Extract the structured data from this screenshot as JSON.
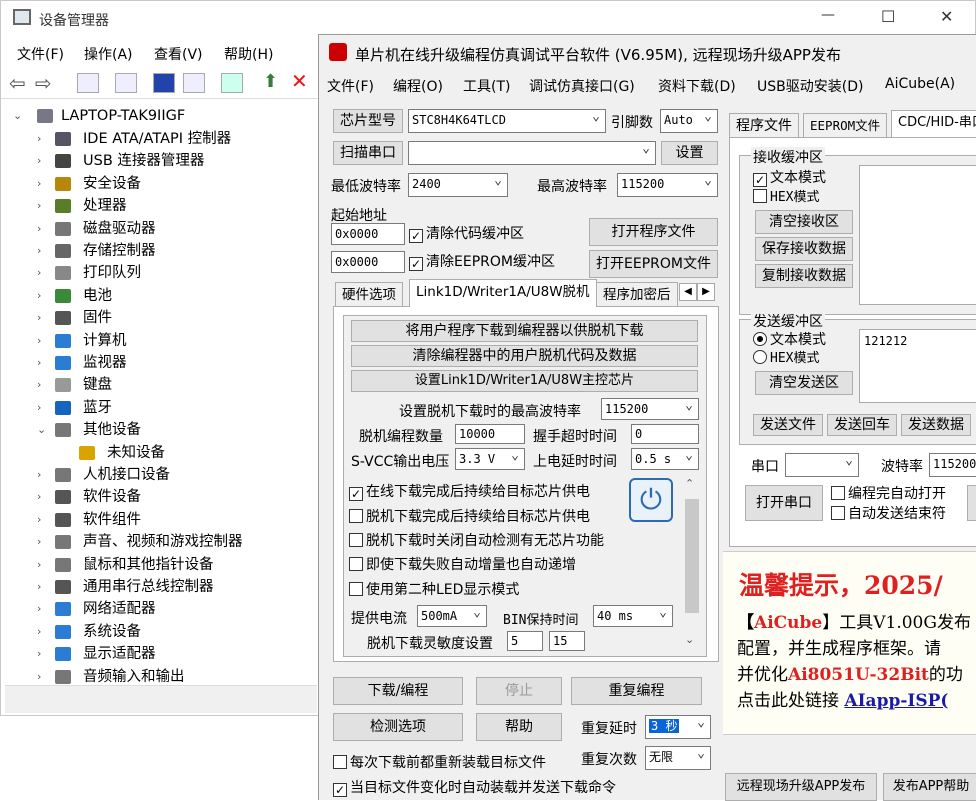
{
  "device_manager": {
    "title": "设备管理器",
    "window_controls": {
      "minimize": "—",
      "maximize": "☐",
      "close": "✕"
    },
    "menu": [
      "文件(F)",
      "操作(A)",
      "查看(V)",
      "帮助(H)"
    ],
    "root": "LAPTOP-TAK9IIGF",
    "tree": [
      {
        "label": "IDE ATA/ATAPI 控制器",
        "icon": "ide-controller-icon",
        "color": "#556"
      },
      {
        "label": "USB 连接器管理器",
        "icon": "usb-connector-icon",
        "color": "#444"
      },
      {
        "label": "安全设备",
        "icon": "security-device-icon",
        "color": "#b8860b"
      },
      {
        "label": "处理器",
        "icon": "processor-icon",
        "color": "#5a7d2a"
      },
      {
        "label": "磁盘驱动器",
        "icon": "disk-drive-icon",
        "color": "#777"
      },
      {
        "label": "存储控制器",
        "icon": "storage-controller-icon",
        "color": "#666"
      },
      {
        "label": "打印队列",
        "icon": "printer-icon",
        "color": "#888"
      },
      {
        "label": "电池",
        "icon": "battery-icon",
        "color": "#3a8a3a"
      },
      {
        "label": "固件",
        "icon": "firmware-icon",
        "color": "#555"
      },
      {
        "label": "计算机",
        "icon": "computer-icon",
        "color": "#2b7cd3"
      },
      {
        "label": "监视器",
        "icon": "monitor-icon",
        "color": "#2b7cd3"
      },
      {
        "label": "键盘",
        "icon": "keyboard-icon",
        "color": "#999"
      },
      {
        "label": "蓝牙",
        "icon": "bluetooth-icon",
        "color": "#1565c0"
      },
      {
        "label": "其他设备",
        "icon": "other-devices-icon",
        "color": "#777",
        "expanded": true
      },
      {
        "label": "未知设备",
        "icon": "unknown-device-warning-icon",
        "color": "#d9a400",
        "child": true
      },
      {
        "label": "人机接口设备",
        "icon": "hid-icon",
        "color": "#777"
      },
      {
        "label": "软件设备",
        "icon": "software-device-icon",
        "color": "#555"
      },
      {
        "label": "软件组件",
        "icon": "software-component-icon",
        "color": "#555"
      },
      {
        "label": "声音、视频和游戏控制器",
        "icon": "sound-icon",
        "color": "#777"
      },
      {
        "label": "鼠标和其他指针设备",
        "icon": "mouse-icon",
        "color": "#777"
      },
      {
        "label": "通用串行总线控制器",
        "icon": "usb-controller-icon",
        "color": "#555"
      },
      {
        "label": "网络适配器",
        "icon": "network-adapter-icon",
        "color": "#2b7cd3"
      },
      {
        "label": "系统设备",
        "icon": "system-device-icon",
        "color": "#2b7cd3"
      },
      {
        "label": "显示适配器",
        "icon": "display-adapter-icon",
        "color": "#2b7cd3"
      },
      {
        "label": "音频输入和输出",
        "icon": "audio-io-icon",
        "color": "#777"
      }
    ]
  },
  "isp": {
    "title": "单片机在线升级编程仿真调试平台软件 (V6.95M), 远程现场升级APP发布",
    "menu": [
      "文件(F)",
      "编程(O)",
      "工具(T)",
      "调试仿真接口(G)",
      "资料下载(D)",
      "USB驱动安装(D)",
      "AiCube(A)"
    ],
    "chip_type_btn": "芯片型号",
    "chip_value": "STC8H4K64TLCD",
    "pin_count_label": "引脚数",
    "pin_count_value": "Auto",
    "scan_port_btn": "扫描串口",
    "port_value": "",
    "settings_btn": "设置",
    "min_baud_label": "最低波特率",
    "min_baud_value": "2400",
    "max_baud_label": "最高波特率",
    "max_baud_value": "115200",
    "start_addr_label": "起始地址",
    "addr1": "0x0000",
    "addr2": "0x0000",
    "clear_code_buf": "清除代码缓冲区",
    "clear_eeprom_buf": "清除EEPROM缓冲区",
    "open_program_btn": "打开程序文件",
    "open_eeprom_btn": "打开EEPROM文件",
    "tabs": [
      "硬件选项",
      "Link1D/Writer1A/U8W脱机",
      "程序加密后"
    ],
    "offline_btn1": "将用户程序下载到编程器以供脱机下载",
    "offline_btn2": "清除编程器中的用户脱机代码及数据",
    "offline_btn3": "设置Link1D/Writer1A/U8W主控芯片",
    "max_offline_baud_label": "设置脱机下载时的最高波特率",
    "max_offline_baud_value": "115200",
    "offline_count_label": "脱机编程数量",
    "offline_count_value": "10000",
    "handshake_label": "握手超时时间",
    "handshake_value": "0",
    "svcc_label": "S-VCC输出电压",
    "svcc_value": "3.3 V",
    "power_delay_label": "上电延时时间",
    "power_delay_value": "0.5 s",
    "opt1": "在线下载完成后持续给目标芯片供电",
    "opt2": "脱机下载完成后持续给目标芯片供电",
    "opt3": "脱机下载时关闭自动检测有无芯片功能",
    "opt4": "即使下载失败自动增量也自动递增",
    "opt5": "使用第二种LED显示模式",
    "current_label": "提供电流",
    "current_value": "500mA",
    "bin_hold_label": "BIN保持时间",
    "bin_hold_value": "40 ms",
    "sensitivity_label": "脱机下载灵敏度设置",
    "sens1": "5",
    "sens2": "15",
    "download_btn": "下载/编程",
    "stop_btn": "停止",
    "reprogram_btn": "重复编程",
    "detect_btn": "检测选项",
    "help_btn": "帮助",
    "repeat_delay_label": "重复延时",
    "repeat_delay_value": "3 秒",
    "repeat_count_label": "重复次数",
    "repeat_count_value": "无限",
    "reload_each": "每次下载前都重新装载目标文件",
    "auto_reload": "当目标文件变化时自动装载并发送下载命令",
    "right_tabs": [
      "程序文件",
      "EEPROM文件",
      "CDC/HID-串口"
    ],
    "recv_group": "接收缓冲区",
    "recv_text_mode": "文本模式",
    "recv_hex_mode": "HEX模式",
    "clear_recv_btn": "清空接收区",
    "save_recv_btn": "保存接收数据",
    "copy_recv_btn": "复制接收数据",
    "send_group": "发送缓冲区",
    "send_text_mode": "文本模式",
    "send_hex_mode": "HEX模式",
    "send_value": "121212",
    "clear_send_btn": "清空发送区",
    "send_file_btn": "发送文件",
    "send_enter_btn": "发送回车",
    "send_data_btn": "发送数据",
    "port_label": "串口",
    "baud_label": "波特率",
    "baud_value": "115200",
    "open_port_btn": "打开串口",
    "auto_open": "编程完自动打开",
    "auto_end": "自动发送结束符",
    "tip_title": "温馨提示，2025/",
    "tip_line1_a": "【",
    "tip_line1_b": "AiCube",
    "tip_line1_c": "】工具V1.00G发布",
    "tip_line2": "配置，并生成程序框架。请",
    "tip_line3_a": "并优化",
    "tip_line3_b": "Ai8051U-32Bit",
    "tip_line3_c": "的功",
    "tip_line4_a": "点击此处链接 ",
    "tip_line4_b": "AIapp-ISP(",
    "remote_btn": "远程现场升级APP发布",
    "publish_help_btn": "发布APP帮助"
  }
}
